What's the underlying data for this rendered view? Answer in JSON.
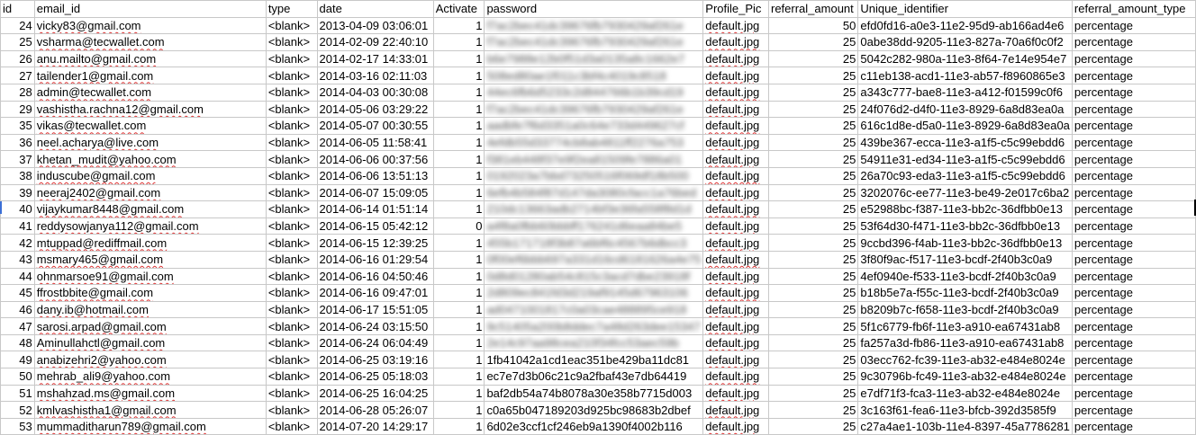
{
  "columns": [
    "id",
    "email_id",
    "type",
    "date",
    "Activate",
    "password",
    "Profile_Pic",
    "referral_amount",
    "Unique_identifier",
    "referral_amount_type"
  ],
  "rows": [
    {
      "id": "24",
      "email": "vicky83@gmail.com",
      "type": "<blank>",
      "date": "2013-04-09 03:06:01",
      "activate": "1",
      "password": "f7ac2bec41dc39676fb7930429af261e",
      "pic": "default.jpg",
      "amount": "50",
      "uid": "efd0fd16-a0e3-11e2-95d9-ab166ad4e6",
      "amt_type": "percentage"
    },
    {
      "id": "25",
      "email": "vsharma@tecwallet.com",
      "type": "<blank>",
      "date": "2014-02-09 22:40:10",
      "activate": "1",
      "password": "f7ac2bec41dc39676fb7930429af261e",
      "pic": "default.jpg",
      "amount": "25",
      "uid": "0abe38dd-9205-11e3-827a-70a6f0c0f2",
      "amt_type": "percentage"
    },
    {
      "id": "26",
      "email": "anu.mailto@gmail.com",
      "type": "<blank>",
      "date": "2014-02-17 14:33:01",
      "activate": "1",
      "password": "b6e7988e12b0f51d3a0135a8c1662e7",
      "pic": "default.jpg",
      "amount": "25",
      "uid": "5042c282-980a-11e3-8f64-7e14e954e7",
      "amt_type": "percentage"
    },
    {
      "id": "27",
      "email": "tailender1@gmail.com",
      "type": "<blank>",
      "date": "2014-03-16 02:11:03",
      "activate": "1",
      "password": "508ed80ae1f011c3bf4c4019c8518",
      "pic": "default.jpg",
      "amount": "25",
      "uid": "c11eb138-acd1-11e3-ab57-f8960865e3",
      "amt_type": "percentage"
    },
    {
      "id": "28",
      "email": "admin@tecwallet.com",
      "type": "<blank>",
      "date": "2014-04-03 00:30:08",
      "activate": "1",
      "password": "44ec6fb6d5233c2d844766b1b39cd19",
      "pic": "default.jpg",
      "amount": "25",
      "uid": "a343c777-bae8-11e3-a412-f01599c0f6",
      "amt_type": "percentage"
    },
    {
      "id": "29",
      "email": "vashistha.rachna12@gmail.com",
      "type": "<blank>",
      "date": "2014-05-06 03:29:22",
      "activate": "1",
      "password": "f7ac2bec41dc39676fb7930429af261e",
      "pic": "default.jpg",
      "amount": "25",
      "uid": "24f076d2-d4f0-11e3-8929-6a8d83ea0a",
      "amt_type": "percentage"
    },
    {
      "id": "35",
      "email": "vikas@tecwallet.com",
      "type": "<blank>",
      "date": "2014-05-07 00:30:55",
      "activate": "1",
      "password": "aadbfe7f6d3351a0c64e733d449627cf",
      "pic": "default.jpg",
      "amount": "25",
      "uid": "616c1d8e-d5a0-11e3-8929-6a8d83ea0a",
      "amt_type": "percentage"
    },
    {
      "id": "36",
      "email": "neel.acharya@live.com",
      "type": "<blank>",
      "date": "2014-06-05 11:58:41",
      "activate": "1",
      "password": "4efdb55d33774cb8ab4811ff2276a753",
      "pic": "default.jpg",
      "amount": "25",
      "uid": "439be367-ecca-11e3-a1f5-c5c99ebdd6",
      "amt_type": "percentage"
    },
    {
      "id": "37",
      "email": "khetan_mudit@yahoo.com",
      "type": "<blank>",
      "date": "2014-06-06 00:37:56",
      "activate": "1",
      "password": "f381eb448f37e9f2ea81509fe7886a01",
      "pic": "default.jpg",
      "amount": "25",
      "uid": "54911e31-ed34-11e3-a1f5-c5c99ebdd6",
      "amt_type": "percentage"
    },
    {
      "id": "38",
      "email": "induscube@gmail.com",
      "type": "<blank>",
      "date": "2014-06-06 13:51:13",
      "activate": "1",
      "password": "0192023a7bbd73250516f069df18b500",
      "pic": "default.jpg",
      "amount": "25",
      "uid": "26a70c93-eda3-11e3-a1f5-c5c99ebdd6",
      "amt_type": "percentage"
    },
    {
      "id": "39",
      "email": "neeraj2402@gmail.com",
      "type": "<blank>",
      "date": "2014-06-07 15:09:05",
      "activate": "1",
      "password": "6efb4b584f87d147da3080cfacc1a76bed",
      "pic": "default.jpg",
      "amount": "25",
      "uid": "3202076c-ee77-11e3-be49-2e017c6ba2",
      "amt_type": "percentage"
    },
    {
      "id": "40",
      "email": "vijaykumar8448@gmail.com",
      "type": "<blank>",
      "date": "2014-06-14 01:51:14",
      "activate": "1",
      "password": "210dc13663adb2714bf3e36fa558f8d1d",
      "pic": "default.jpg",
      "amount": "25",
      "uid": "e52988bc-f387-11e3-bb2c-36dfbb0e13",
      "amt_type": "percentage"
    },
    {
      "id": "41",
      "email": "reddysowjanya112@gmail.com",
      "type": "<blank>",
      "date": "2014-06-15 05:42:12",
      "activate": "0",
      "password": "a4f8a0fbb60bbbff176241d6eaa84be5",
      "pic": "default.jpg",
      "amount": "25",
      "uid": "53f64d30-f471-11e3-bb2c-36dfbb0e13",
      "amt_type": "percentage"
    },
    {
      "id": "42",
      "email": "mtuppad@rediffmail.com",
      "type": "<blank>",
      "date": "2014-06-15 12:39:25",
      "activate": "1",
      "password": "455b171718f3b87a6bf6c4567b6dbcc3",
      "pic": "default.jpg",
      "amount": "25",
      "uid": "9ccbd396-f4ab-11e3-bb2c-36dfbb0e13",
      "amt_type": "percentage"
    },
    {
      "id": "43",
      "email": "msmary465@gmail.com",
      "type": "<blank>",
      "date": "2014-06-16 01:29:54",
      "activate": "1",
      "password": "0f00ef6bbb697a331d16cd6181626a4e75",
      "pic": "default.jpg",
      "amount": "25",
      "uid": "3f80f9ac-f517-11e3-bcdf-2f40b3c0a9",
      "amt_type": "percentage"
    },
    {
      "id": "44",
      "email": "ohnmarsoe91@gmail.com",
      "type": "<blank>",
      "date": "2014-06-16 04:50:46",
      "activate": "1",
      "password": "0d8d01280ab54c815c3acd7dbe23918f",
      "pic": "default.jpg",
      "amount": "25",
      "uid": "4ef0940e-f533-11e3-bcdf-2f40b3c0a9",
      "amt_type": "percentage"
    },
    {
      "id": "45",
      "email": "ffrostbbite@gmail.com",
      "type": "<blank>",
      "date": "2014-06-16 09:47:01",
      "activate": "1",
      "password": "2d809ec841fd3d219af9145d67963106",
      "pic": "default.jpg",
      "amount": "25",
      "uid": "b18b5e7a-f55c-11e3-bcdf-2f40b3c0a9",
      "amt_type": "percentage"
    },
    {
      "id": "46",
      "email": "dany.ib@hotmail.com",
      "type": "<blank>",
      "date": "2014-06-17 15:51:05",
      "activate": "1",
      "password": "ad0471001817c0a03cae488895ce918",
      "pic": "default.jpg",
      "amount": "25",
      "uid": "b8209b7c-f658-11e3-bcdf-2f40b3c0a9",
      "amt_type": "percentage"
    },
    {
      "id": "47",
      "email": "sarosi.arpad@gmail.com",
      "type": "<blank>",
      "date": "2014-06-24 03:15:50",
      "activate": "1",
      "password": "9c51405a200b8ddec7a48d263dee15347",
      "pic": "default.jpg",
      "amount": "25",
      "uid": "5f1c6779-fb6f-11e3-a910-ea67431ab8",
      "amt_type": "percentage"
    },
    {
      "id": "48",
      "email": "Aminullahctl@gmail.com",
      "type": "<blank>",
      "date": "2014-06-24 06:04:49",
      "activate": "1",
      "password": "2e14c97aa98cea210f34fcc53aec59b",
      "pic": "default.jpg",
      "amount": "25",
      "uid": "fa257a3d-fb86-11e3-a910-ea67431ab8",
      "amt_type": "percentage"
    },
    {
      "id": "49",
      "email": "anabizehri2@yahoo.com",
      "type": "<blank>",
      "date": "2014-06-25 03:19:16",
      "activate": "1",
      "password": "1fb41042a1cd1eac351be429ba11dc81",
      "pic": "default.jpg",
      "amount": "25",
      "uid": "03ecc762-fc39-11e3-ab32-e484e8024e",
      "amt_type": "percentage"
    },
    {
      "id": "50",
      "email": "mehrab_ali9@yahoo.com",
      "type": "<blank>",
      "date": "2014-06-25 05:18:03",
      "activate": "1",
      "password": "ec7e7d3b06c21c9a2fbaf43e7db64419",
      "pic": "default.jpg",
      "amount": "25",
      "uid": "9c30796b-fc49-11e3-ab32-e484e8024e",
      "amt_type": "percentage"
    },
    {
      "id": "51",
      "email": "mshahzad.ms@gmail.com",
      "type": "<blank>",
      "date": "2014-06-25 16:04:25",
      "activate": "1",
      "password": "baf2db54a74b8078a30e358b7715d003",
      "pic": "default.jpg",
      "amount": "25",
      "uid": "e7df71f3-fca3-11e3-ab32-e484e8024e",
      "amt_type": "percentage"
    },
    {
      "id": "52",
      "email": "kmlvashistha1@gmail.com",
      "type": "<blank>",
      "date": "2014-06-28 05:26:07",
      "activate": "1",
      "password": "c0a65b047189203d925bc98683b2dbef",
      "pic": "default.jpg",
      "amount": "25",
      "uid": "3c163f61-fea6-11e3-bfcb-392d3585f9",
      "amt_type": "percentage"
    },
    {
      "id": "53",
      "email": "mummaditharun789@gmail.com",
      "type": "<blank>",
      "date": "2014-07-20 14:29:17",
      "activate": "1",
      "password": "6d02e3ccf1cf246eb9a1390f4002b116",
      "pic": "default.jpg",
      "amount": "25",
      "uid": "c27a4ae1-103b-11e4-8397-45a7786281",
      "amt_type": "percentage"
    }
  ],
  "blurred_rows": 20,
  "colors": {
    "grid": "#c8c8c8",
    "spellcheck": "#dd3333",
    "selection_marker": "#3b6fd6"
  }
}
